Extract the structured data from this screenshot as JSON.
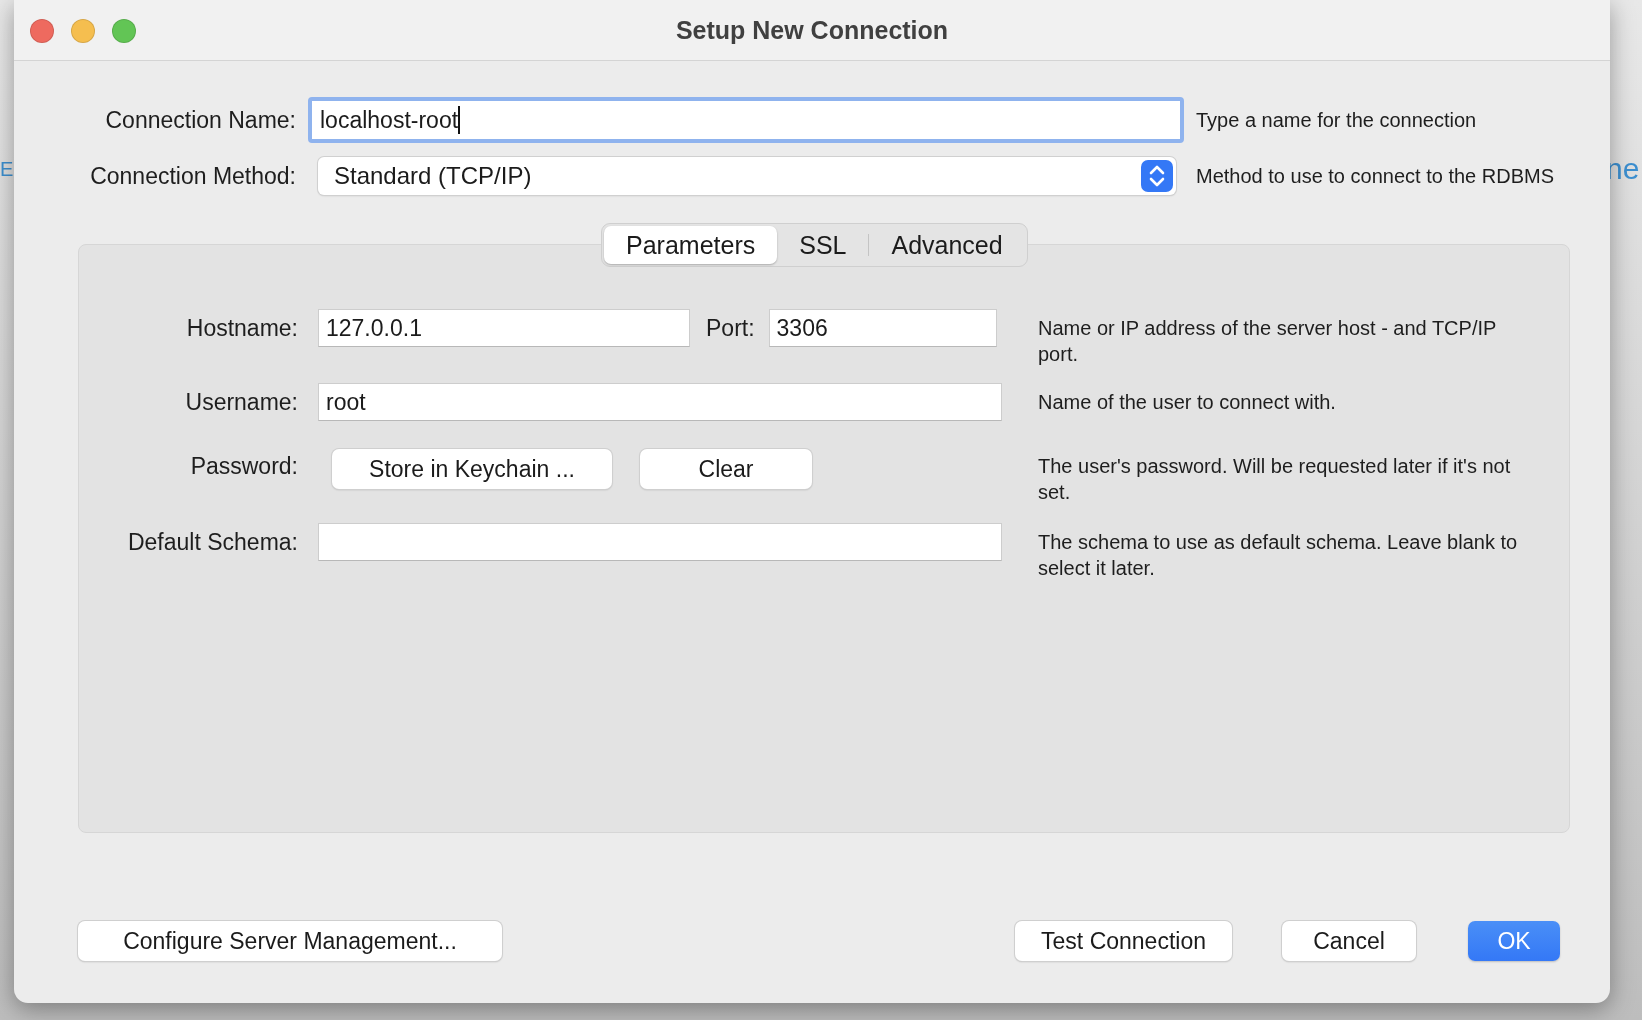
{
  "background": {
    "left_fragment": "E",
    "right_fragment": "ne"
  },
  "window": {
    "title": "Setup New Connection"
  },
  "connection_name": {
    "label": "Connection Name:",
    "value": "localhost-root",
    "focused": true,
    "hint": "Type a name for the connection"
  },
  "connection_method": {
    "label": "Connection Method:",
    "value": "Standard (TCP/IP)",
    "hint": "Method to use to connect to the RDBMS"
  },
  "tabs": [
    {
      "label": "Parameters",
      "selected": true
    },
    {
      "label": "SSL",
      "selected": false
    },
    {
      "label": "Advanced",
      "selected": false
    }
  ],
  "parameters": {
    "hostname": {
      "label": "Hostname:",
      "value": "127.0.0.1"
    },
    "port": {
      "label": "Port:",
      "value": "3306"
    },
    "host_hint": "Name or IP address of the server host - and TCP/IP port.",
    "username": {
      "label": "Username:",
      "value": "root",
      "hint": "Name of the user to connect with."
    },
    "password": {
      "label": "Password:",
      "buttons": [
        "Store in Keychain ...",
        "Clear"
      ],
      "hint": "The user's password. Will be requested later if it's not set."
    },
    "default_schema": {
      "label": "Default Schema:",
      "hint": "The schema to use as default schema. Leave blank to select it later."
    }
  },
  "footer": {
    "left_button": "Configure Server Management...",
    "buttons": [
      {
        "label": "Test Connection",
        "kind": "plain"
      },
      {
        "label": "Cancel",
        "kind": "plain"
      },
      {
        "label": "OK",
        "kind": "default"
      }
    ]
  }
}
